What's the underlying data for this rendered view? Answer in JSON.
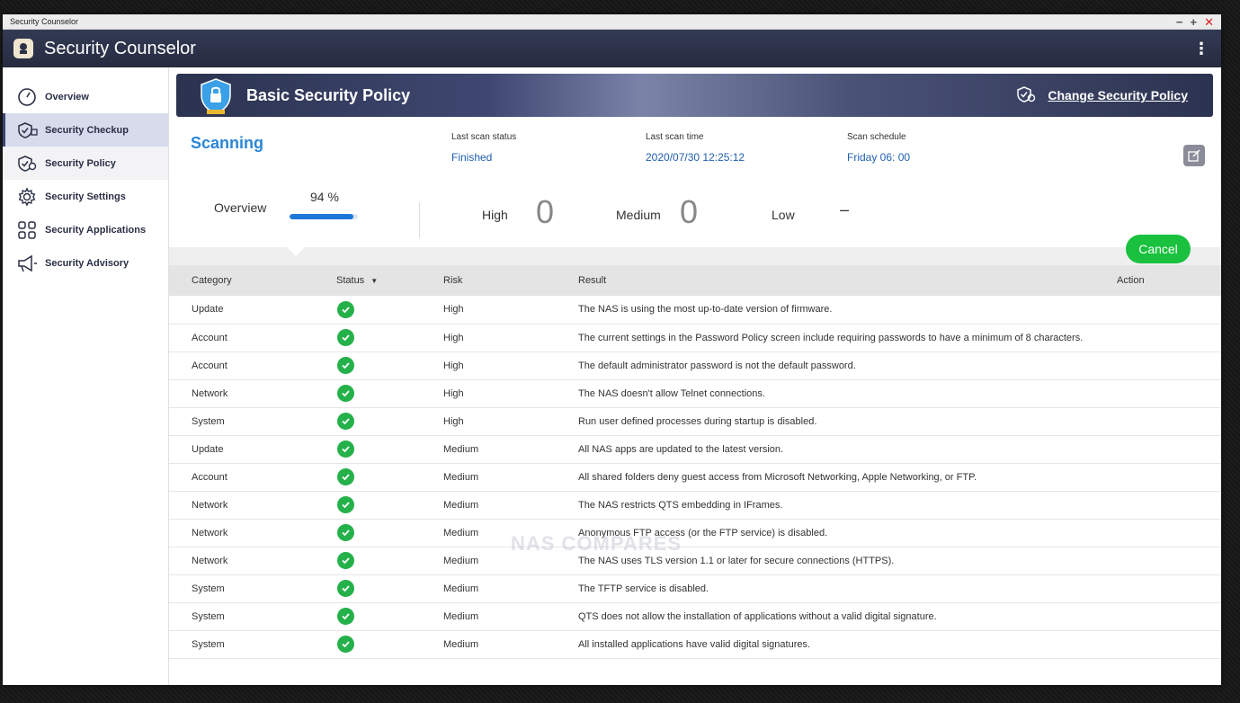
{
  "os_window": {
    "title": "Security Counselor"
  },
  "app": {
    "title": "Security Counselor"
  },
  "sidebar": {
    "items": [
      {
        "label": "Overview",
        "icon": "gauge-icon"
      },
      {
        "label": "Security Checkup",
        "icon": "shield-check-icon"
      },
      {
        "label": "Security Policy",
        "icon": "shield-gear-icon"
      },
      {
        "label": "Security Settings",
        "icon": "gear-icon"
      },
      {
        "label": "Security Applications",
        "icon": "apps-grid-icon"
      },
      {
        "label": "Security Advisory",
        "icon": "megaphone-icon"
      }
    ]
  },
  "banner": {
    "title": "Basic Security Policy",
    "change_label": "Change Security Policy"
  },
  "scan": {
    "state": "Scanning",
    "last_status_label": "Last scan status",
    "last_status": "Finished",
    "last_time_label": "Last scan time",
    "last_time": "2020/07/30 12:25:12",
    "schedule_label": "Scan schedule",
    "schedule": "Friday 06: 00"
  },
  "summary": {
    "overview_label": "Overview",
    "progress_text": "94 %",
    "progress": 0.94,
    "high_label": "High",
    "high_count": "0",
    "medium_label": "Medium",
    "medium_count": "0",
    "low_label": "Low",
    "low_count": "–"
  },
  "cancel_label": "Cancel",
  "watermark": "NAS COMPARES",
  "table": {
    "headers": {
      "category": "Category",
      "status": "Status",
      "risk": "Risk",
      "result": "Result",
      "action": "Action"
    },
    "rows": [
      {
        "category": "Update",
        "risk": "High",
        "result": "The NAS is using the most up-to-date version of firmware."
      },
      {
        "category": "Account",
        "risk": "High",
        "result": "The current settings in the Password Policy screen include requiring passwords to have a minimum of 8 characters."
      },
      {
        "category": "Account",
        "risk": "High",
        "result": "The default administrator password is not the default password."
      },
      {
        "category": "Network",
        "risk": "High",
        "result": "The NAS doesn't allow Telnet connections."
      },
      {
        "category": "System",
        "risk": "High",
        "result": "Run user defined processes during startup is disabled."
      },
      {
        "category": "Update",
        "risk": "Medium",
        "result": "All NAS apps are updated to the latest version."
      },
      {
        "category": "Account",
        "risk": "Medium",
        "result": "All shared folders deny guest access from Microsoft Networking, Apple Networking, or FTP."
      },
      {
        "category": "Network",
        "risk": "Medium",
        "result": "The NAS restricts QTS embedding in IFrames."
      },
      {
        "category": "Network",
        "risk": "Medium",
        "result": "Anonymous FTP access (or the FTP service) is disabled."
      },
      {
        "category": "Network",
        "risk": "Medium",
        "result": "The NAS uses TLS version 1.1 or later for secure connections (HTTPS)."
      },
      {
        "category": "System",
        "risk": "Medium",
        "result": "The TFTP service is disabled."
      },
      {
        "category": "System",
        "risk": "Medium",
        "result": "QTS does not allow the installation of applications without a valid digital signature."
      },
      {
        "category": "System",
        "risk": "Medium",
        "result": "All installed applications have valid digital signatures."
      },
      {
        "category": "",
        "risk": "",
        "result": ""
      }
    ]
  },
  "colors": {
    "header_bg": "#2b3048",
    "accent_blue": "#2a86d6",
    "ok_green": "#25b14a",
    "cancel_green": "#19c13e",
    "close_red": "#d62020"
  }
}
